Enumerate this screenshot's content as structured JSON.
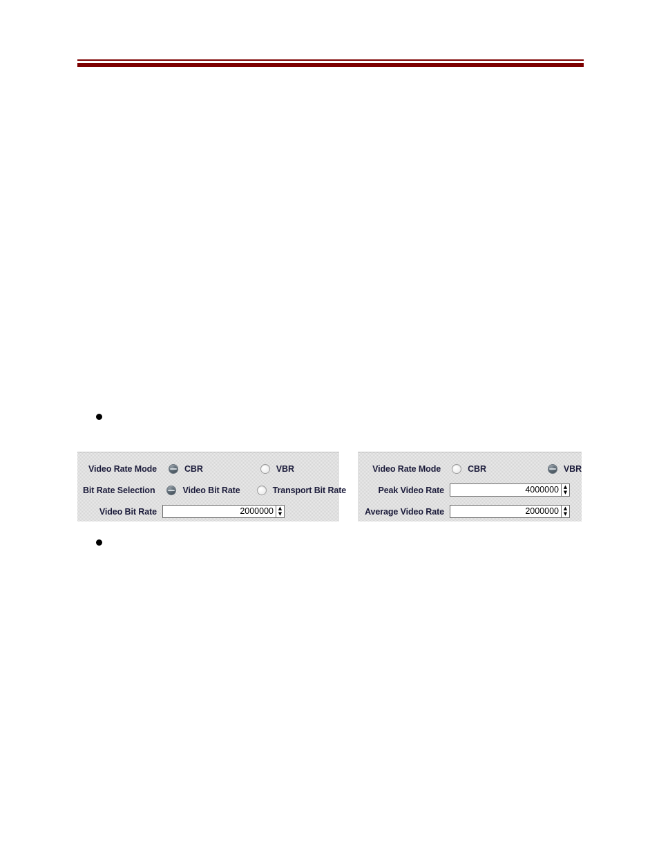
{
  "header": {
    "rule_color": "#7d0000"
  },
  "bullets": [
    {
      "text": ""
    },
    {
      "text": ""
    }
  ],
  "panels": [
    {
      "id": "cbr",
      "rows": [
        {
          "label": "Video Rate Mode",
          "type": "radio",
          "options": [
            {
              "label": "CBR",
              "selected": true
            },
            {
              "label": "VBR",
              "selected": false
            }
          ]
        },
        {
          "label": "Bit Rate Selection",
          "type": "radio",
          "options": [
            {
              "label": "Video Bit Rate",
              "selected": true
            },
            {
              "label": "Transport Bit Rate",
              "selected": false
            }
          ]
        },
        {
          "label": "Video Bit Rate",
          "type": "spinner",
          "value": "2000000",
          "up_icon": "chevron-up-icon",
          "down_icon": "chevron-down-icon"
        }
      ]
    },
    {
      "id": "vbr",
      "rows": [
        {
          "label": "Video Rate Mode",
          "type": "radio",
          "options": [
            {
              "label": "CBR",
              "selected": false
            },
            {
              "label": "VBR",
              "selected": true
            }
          ]
        },
        {
          "label": "Peak Video Rate",
          "type": "spinner",
          "value": "4000000",
          "up_icon": "chevron-up-icon",
          "down_icon": "chevron-down-icon"
        },
        {
          "label": "Average Video Rate",
          "type": "spinner",
          "value": "2000000",
          "up_icon": "chevron-up-icon",
          "down_icon": "chevron-down-icon"
        }
      ]
    }
  ]
}
